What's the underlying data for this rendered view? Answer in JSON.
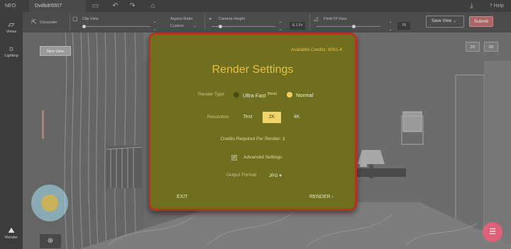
{
  "topbar": {
    "logo": "NEO",
    "project_name": "Dvdbdr0007",
    "help": "Help"
  },
  "toolbar": {
    "mode_label": "Concealer",
    "clip_view": "Clip View",
    "aspect_ratio_label": "Aspect Ratio:",
    "aspect_ratio_value": "Custom",
    "camera_height_label": "Camera Height",
    "camera_height_value": "6.1 Ft",
    "fov_label": "Field Of View",
    "fov_value": "76",
    "save_view": "Save View",
    "submit": "Submit"
  },
  "sidebar": {
    "views": "Views",
    "lighting": "Lighting",
    "render": "Render"
  },
  "viewport": {
    "new_view": "New View",
    "btn_2d": "2D",
    "btn_3d": "3D"
  },
  "modal": {
    "available_credits": "Available Credits: 8061.4",
    "title": "Render Settings",
    "render_type_label": "Render Type",
    "render_types": [
      {
        "label": "Ultra Fast",
        "tag": "(Beta)",
        "selected": false
      },
      {
        "label": "Normal",
        "selected": true
      }
    ],
    "resolution_label": "Resolution",
    "resolutions": [
      {
        "label": "Test",
        "selected": false
      },
      {
        "label": "2K",
        "selected": true
      },
      {
        "label": "4K",
        "selected": false
      }
    ],
    "credits_required": "Credits Required Per Render:  3",
    "advanced_settings": "Advanced Settings",
    "advanced_checked": true,
    "output_format_label": "Output Format",
    "output_format_value": "JPG",
    "exit": "EXIT",
    "render": "RENDER"
  },
  "colors": {
    "modal_bg": "#6f6f1f",
    "modal_border": "#b2351c",
    "accent": "#e8c040",
    "submit": "#a66666",
    "chat": "#e0607a"
  }
}
